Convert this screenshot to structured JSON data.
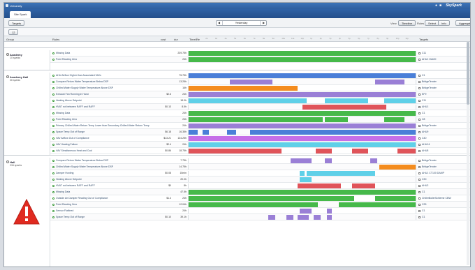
{
  "window": {
    "title": "Univarsity",
    "brand": "SkySpark"
  },
  "tab": {
    "label": "Site Spark"
  },
  "toolbar": {
    "targets_label": "Targets",
    "date_value": "Yesterday",
    "view_label": "View",
    "timeline_label": "Timeline",
    "rules_label": "Rules",
    "select_label": "Select",
    "info_label": "Info",
    "aggregate_label": "Aggregate",
    "filter_label": "12"
  },
  "columns": {
    "group": "Group",
    "rules": "Rules",
    "cost": "cost",
    "dur": "dur",
    "timeline": "Timeline",
    "targets": "Targets"
  },
  "axis_ticks": [
    "1a",
    "2a",
    "3a",
    "4a",
    "5a",
    "6a",
    "7a",
    "8a",
    "9a",
    "10a",
    "11a",
    "12p",
    "1p",
    "2p",
    "3p",
    "4p",
    "5p",
    "6p",
    "7p",
    "8p",
    "9p",
    "10p",
    "11p"
  ],
  "groups": [
    {
      "name": "Academy",
      "sub": "10 sparks"
    },
    {
      "name": "Academy Hall",
      "sub": "36 sparks"
    },
    {
      "name": "Hall",
      "sub": "234 sparks"
    }
  ],
  "rows": [
    {
      "name": "Missing Data",
      "cost": "",
      "dur": "239.75h",
      "target": "C11"
    },
    {
      "name": "Point Reading Zero",
      "cost": "",
      "dur": "24h",
      "target": "AHU1 OAMX"
    },
    {
      "name": "AHU Airflow Higher than Associated VAVs",
      "cost": "",
      "dur": "75.75h",
      "target": "C1"
    },
    {
      "name": "Compare Return Water Temperature Below DSP",
      "cost": "",
      "dur": "13.25h",
      "target": "BridgeTender"
    },
    {
      "name": "Chilled Water Supply Water Temperature Above DSP",
      "cost": "",
      "dur": "16h",
      "target": "BridgeTender"
    },
    {
      "name": "Exhaust Fan Running in Hand",
      "cost": "$2.6",
      "dur": "24h",
      "target": "EF9"
    },
    {
      "name": "Heating Above Setpoint",
      "cost": "",
      "dur": "18.0h",
      "target": "C11"
    },
    {
      "name": "HVAT not between RAFF and RAFF",
      "cost": "$0.13",
      "dur": "8.5h",
      "target": "AHU1"
    },
    {
      "name": "Missing Data",
      "cost": "",
      "dur": "24h",
      "target": "C1"
    },
    {
      "name": "Point Reading Zero",
      "cost": "",
      "dur": "24h",
      "target": "C8"
    },
    {
      "name": "Primary Chilled Water Return Temp Lower than Secondary Chilled Water Return Temp",
      "cost": "",
      "dur": "24h",
      "target": "BridgeTender"
    },
    {
      "name": "Space Temp Out of Range",
      "cost": "$6.18",
      "dur": "16.35h",
      "target": "AHU9"
    },
    {
      "name": "VAV Airflow Out of Compliance",
      "cost": "$13.21",
      "dur": "134.25h",
      "target": "C40"
    },
    {
      "name": "VAV Heating Failure",
      "cost": "$2.4",
      "dur": "24h",
      "target": "AHU14"
    },
    {
      "name": "VAV Simultaneous Heat and Cool",
      "cost": "$0.86",
      "dur": "18.75h",
      "target": "AHU8"
    },
    {
      "name": "Compare Return Water Temperature Below DSP",
      "cost": "",
      "dur": "7.75h",
      "target": "BridgeTender"
    },
    {
      "name": "Chilled Water Supply Water Temperature Above DSP",
      "cost": "",
      "dur": "14.75h",
      "target": "BridgeTender"
    },
    {
      "name": "Damper Hunting",
      "cost": "$0.08",
      "dur": "15min",
      "target": "AHU1 CT100 DAMP"
    },
    {
      "name": "Heating Above Setpoint",
      "cost": "",
      "dur": "20.0h",
      "target": "C30"
    },
    {
      "name": "HVAT not between RAFF and RAFF",
      "cost": "$0",
      "dur": "8h",
      "target": "AHU2"
    },
    {
      "name": "Missing Data",
      "cost": "",
      "dur": "47.5h",
      "target": "C1"
    },
    {
      "name": "Outside Air Damper Reading Out of Compliance",
      "cost": "$1.4",
      "dur": "24h",
      "target": "ChillerBoilerSchieme CBW"
    },
    {
      "name": "Point Reading Zero",
      "cost": "",
      "dur": "12.04h",
      "target": "C25"
    },
    {
      "name": "Sensor Flatlined",
      "cost": "",
      "dur": "24h",
      "target": "C1"
    },
    {
      "name": "Space Temp Out of Range",
      "cost": "$0.10",
      "dur": "39.1h",
      "target": "C1"
    }
  ],
  "bar_fractions": [
    [
      [
        0,
        1
      ]
    ],
    [
      [
        0,
        1
      ]
    ],
    [
      [
        0,
        1
      ]
    ],
    [
      [
        0.18,
        0.37
      ],
      [
        0.82,
        0.95
      ]
    ],
    [
      [
        0,
        0.48
      ]
    ],
    [
      [
        0,
        1
      ]
    ],
    [
      [
        0,
        0.52
      ],
      [
        0.6,
        0.79
      ],
      [
        0.86,
        1
      ]
    ],
    [
      [
        0.5,
        0.87
      ]
    ],
    [
      [
        0,
        1
      ]
    ],
    [
      [
        0,
        0.59
      ],
      [
        0.6,
        0.7
      ],
      [
        0.86,
        0.95
      ]
    ],
    [
      [
        0,
        1
      ]
    ],
    [
      [
        0,
        0.04
      ],
      [
        0.06,
        0.09
      ],
      [
        0.17,
        0.21
      ],
      [
        0.27,
        1
      ]
    ],
    [
      [
        0,
        1
      ]
    ],
    [
      [
        0,
        1
      ]
    ],
    [
      [
        0,
        0.41
      ],
      [
        0.56,
        0.63
      ],
      [
        0.72,
        0.79
      ],
      [
        0.92,
        1
      ]
    ],
    [
      [
        0.45,
        0.54
      ],
      [
        0.6,
        0.63
      ],
      [
        0.8,
        0.83
      ]
    ],
    [
      [
        0.84,
        1
      ]
    ],
    [
      [
        0.49,
        0.51
      ],
      [
        0.52,
        0.82
      ]
    ],
    [
      [
        0.49,
        0.54
      ]
    ],
    [
      [
        0.48,
        0.67
      ],
      [
        0.72,
        0.82
      ]
    ],
    [
      [
        0,
        1
      ]
    ],
    [
      [
        0,
        0.73
      ],
      [
        0.82,
        1
      ]
    ],
    [
      [
        0,
        0.57
      ],
      [
        0.66,
        1
      ]
    ],
    [
      [
        0.49,
        0.54
      ],
      [
        0.61,
        0.63
      ]
    ],
    [
      [
        0.35,
        0.38
      ],
      [
        0.43,
        0.46
      ],
      [
        0.48,
        0.53
      ],
      [
        0.55,
        0.58
      ],
      [
        0.61,
        0.63
      ]
    ]
  ],
  "row_colors": [
    "#46b94a",
    "#46b94a",
    "#4a7fd8",
    "#9a7fd6",
    "#f48c1e",
    "#9a7fd6",
    "#5fd0e8",
    "#e0545a",
    "#46b94a",
    "#46b94a",
    "#9a7fd6",
    "#4a7fd8",
    "#c56fe8",
    "#5fd0e8",
    "#e0545a",
    "#9a7fd6",
    "#f48c1e",
    "#5fd0e8",
    "#5fd0e8",
    "#e0545a",
    "#46b94a",
    "#46b94a",
    "#46b94a",
    "#9a7fd6",
    "#9a7fd6"
  ]
}
